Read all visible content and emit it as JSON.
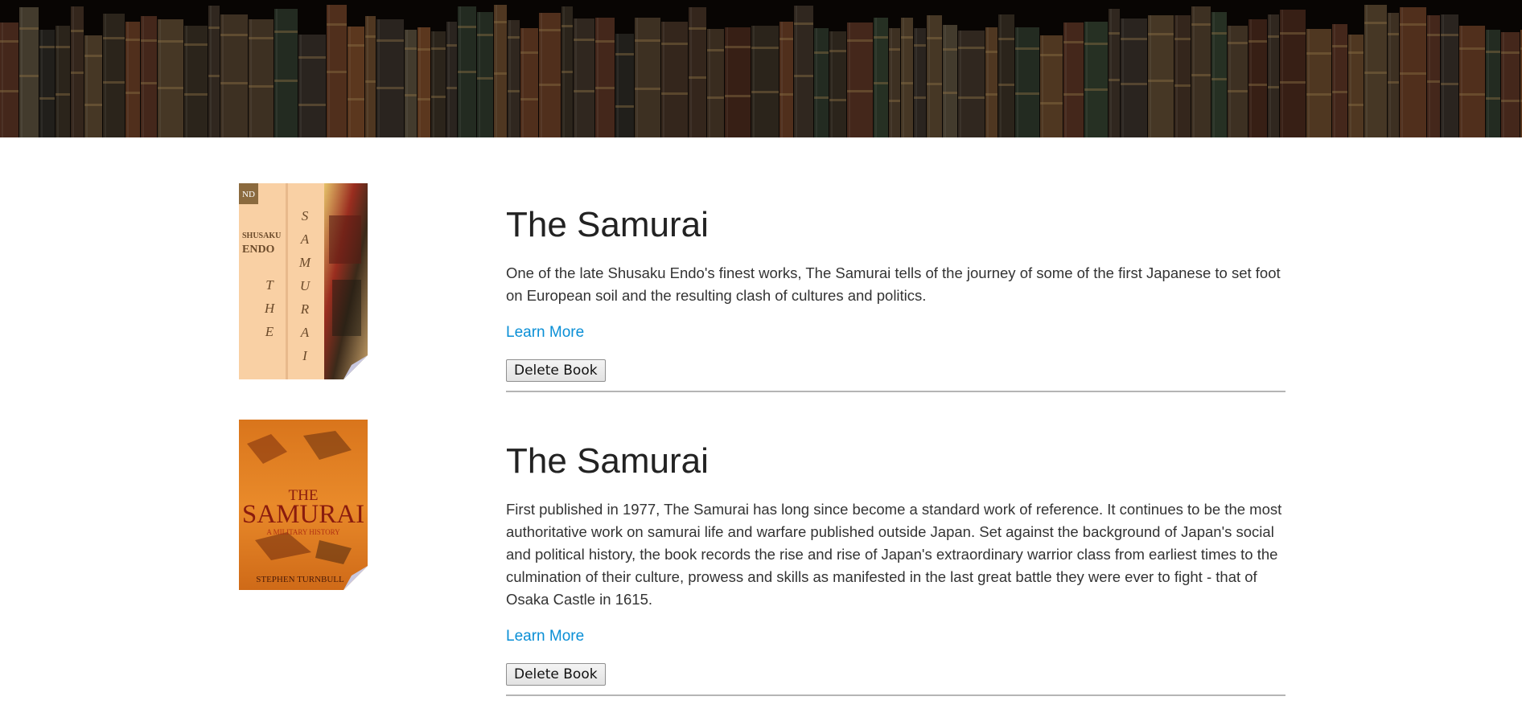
{
  "banner": {
    "alt": "bookshelf-banner"
  },
  "books": [
    {
      "title": "The Samurai",
      "description": "One of the late Shusaku Endo's finest works, The Samurai tells of the journey of some of the first Japanese to set foot on European soil and the resulting clash of cultures and politics.",
      "learn_more": "Learn More",
      "delete_label": "Delete Book",
      "cover": {
        "publisher_mark": "ND",
        "author_first": "SHUSAKU",
        "author_last": "ENDO",
        "spine_left": [
          "T",
          "H",
          "E"
        ],
        "spine_right": [
          "S",
          "A",
          "M",
          "U",
          "R",
          "A",
          "I"
        ]
      }
    },
    {
      "title": "The Samurai",
      "description": "First published in 1977, The Samurai has long since become a standard work of reference. It continues to be the most authoritative work on samurai life and warfare published outside Japan. Set against the background of Japan's social and political history, the book records the rise and rise of Japan's extraordinary warrior class from earliest times to the culmination of their culture, prowess and skills as manifested in the last great battle they were ever to fight - that of Osaka Castle in 1615.",
      "learn_more": "Learn More",
      "delete_label": "Delete Book",
      "cover": {
        "title_top": "THE",
        "title_main": "SAMURAI",
        "subtitle": "A MILITARY HISTORY",
        "author": "STEPHEN TURNBULL"
      }
    }
  ],
  "colors": {
    "link": "#0a8fd6",
    "banner_bg": "#0a0604"
  }
}
